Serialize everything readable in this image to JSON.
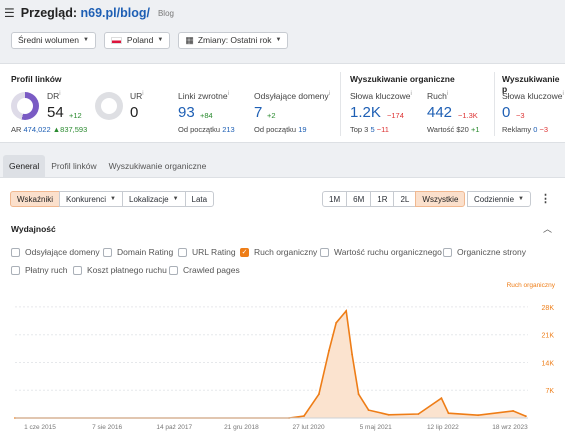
{
  "header": {
    "menu_icon": "hamburger-icon",
    "title_prefix": "Przegląd:",
    "url": "n69.pl/blog/",
    "crumb": "Blog"
  },
  "filters": {
    "volume": "Średni wolumen",
    "country": "Poland",
    "changes": "Zmiany: Ostatni rok"
  },
  "backlink_profile": {
    "heading": "Profil linków",
    "dr_label": "DR",
    "dr_value": "54",
    "dr_delta": "+12",
    "ar_label": "AR",
    "ar_value": "474,022",
    "ar_delta": "▲837,593",
    "ur_label": "UR",
    "ur_value": "0",
    "backlinks_label": "Linki zwrotne",
    "backlinks_value": "93",
    "backlinks_delta": "+84",
    "backlinks_since_label": "Od początku",
    "backlinks_since_value": "213",
    "refdomains_label": "Odsyłające domeny",
    "refdomains_value": "7",
    "refdomains_delta": "+2",
    "refdomains_since_label": "Od początku",
    "refdomains_since_value": "19"
  },
  "organic": {
    "heading": "Wyszukiwanie organiczne",
    "keywords_label": "Słowa kluczowe",
    "keywords_value": "1.2K",
    "keywords_delta": "−174",
    "top3_label": "Top 3",
    "top3_value": "5",
    "top3_delta": "−11",
    "traffic_label": "Ruch",
    "traffic_value": "442",
    "traffic_delta": "−1.3K",
    "value_label": "Wartość",
    "value_value": "$20",
    "value_delta": "+1"
  },
  "paid": {
    "heading": "Wyszukiwanie p",
    "keywords_label": "Słowa kluczowe",
    "keywords_value": "0",
    "keywords_delta": "−3",
    "ads_label": "Reklamy",
    "ads_value": "0",
    "ads_delta": "−3"
  },
  "tabs": [
    "General",
    "Profil linków",
    "Wyszukiwanie organiczne"
  ],
  "toolbar": {
    "views": [
      "Wskaźniki",
      "Konkurenci",
      "Lokalizacje",
      "Lata"
    ],
    "periods": [
      "1M",
      "6M",
      "1R",
      "2L",
      "Wszystkie"
    ],
    "interval": "Codziennie"
  },
  "performance": {
    "heading": "Wydajność",
    "checkboxes": [
      {
        "label": "Odsyłające domeny",
        "checked": false
      },
      {
        "label": "Domain Rating",
        "checked": false
      },
      {
        "label": "URL Rating",
        "checked": false
      },
      {
        "label": "Ruch organiczny",
        "checked": true
      },
      {
        "label": "Wartość ruchu organicznego",
        "checked": false
      },
      {
        "label": "Organiczne strony",
        "checked": false
      },
      {
        "label": "Płatny ruch",
        "checked": false
      },
      {
        "label": "Koszt płatnego ruchu",
        "checked": false
      },
      {
        "label": "Crawled pages",
        "checked": false
      }
    ]
  },
  "colors": {
    "accent": "#ee7d17",
    "area": "#fbe3cf",
    "dr_ring": "#7a5bc4",
    "link": "#1e5fb4"
  },
  "chart_data": {
    "type": "area",
    "series": [
      {
        "name": "Ruch organiczny",
        "points": [
          [
            "2015-06-01",
            0
          ],
          [
            "2020-01-01",
            0
          ],
          [
            "2020-04-01",
            500
          ],
          [
            "2020-07-01",
            6000
          ],
          [
            "2020-09-01",
            17000
          ],
          [
            "2020-10-15",
            24000
          ],
          [
            "2020-12-15",
            27000
          ],
          [
            "2021-01-20",
            16000
          ],
          [
            "2021-03-01",
            6000
          ],
          [
            "2021-05-01",
            2000
          ],
          [
            "2021-09-01",
            800
          ],
          [
            "2022-03-01",
            1000
          ],
          [
            "2022-07-20",
            5000
          ],
          [
            "2022-09-01",
            1200
          ],
          [
            "2023-03-01",
            700
          ],
          [
            "2023-10-01",
            1800
          ],
          [
            "2023-12-18",
            442
          ]
        ]
      }
    ],
    "ylabel_series": "Ruch organiczny",
    "ylim": [
      0,
      30000
    ],
    "yticks": [
      0,
      7000,
      14000,
      21000,
      28000
    ],
    "ytick_labels": [
      "0",
      "7K",
      "14K",
      "21K",
      "28K"
    ],
    "xtick_labels": [
      "1 cze 2015",
      "7 sie 2016",
      "14 paź 2017",
      "21 gru 2018",
      "27 lut 2020",
      "5 maj 2021",
      "12 lip 2022",
      "18 wrz 2023"
    ],
    "xlim": [
      "2015-06-01",
      "2023-12-31"
    ],
    "grid": true
  }
}
